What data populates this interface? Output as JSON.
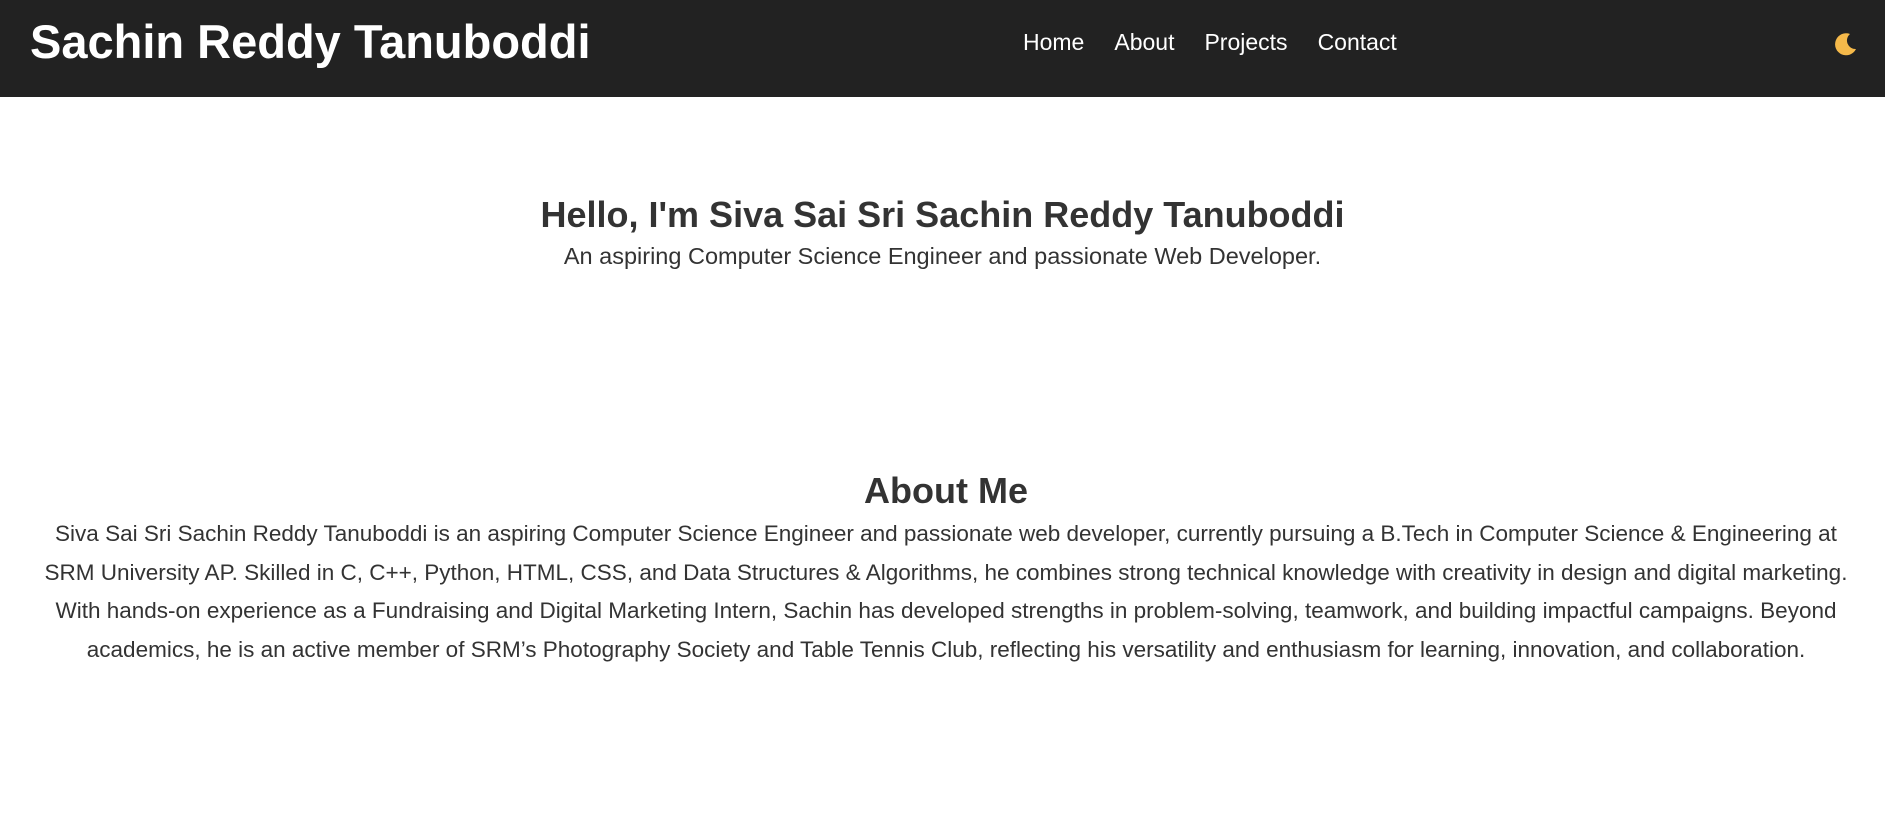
{
  "header": {
    "brand": "Sachin Reddy Tanuboddi",
    "nav": [
      {
        "label": "Home"
      },
      {
        "label": "About"
      },
      {
        "label": "Projects"
      },
      {
        "label": "Contact"
      }
    ],
    "theme_toggle_icon": "moon-icon"
  },
  "hero": {
    "title": "Hello, I'm Siva Sai Sri Sachin Reddy Tanuboddi",
    "subtitle": "An aspiring Computer Science Engineer and passionate Web Developer."
  },
  "about": {
    "title": "About Me",
    "body": "Siva Sai Sri Sachin Reddy Tanuboddi is an aspiring Computer Science Engineer and passionate web developer, currently pursuing a B.Tech in Computer Science & Engineering at SRM University AP. Skilled in C, C++, Python, HTML, CSS, and Data Structures & Algorithms, he combines strong technical knowledge with creativity in design and digital marketing. With hands-on experience as a Fundraising and Digital Marketing Intern, Sachin has developed strengths in problem-solving, teamwork, and building impactful campaigns. Beyond academics, he is an active member of SRM’s Photography Society and Table Tennis Club, reflecting his versatility and enthusiasm for learning, innovation, and collaboration."
  },
  "colors": {
    "navbar_bg": "#222222",
    "text": "#333333",
    "moon": "#f5b94a"
  }
}
